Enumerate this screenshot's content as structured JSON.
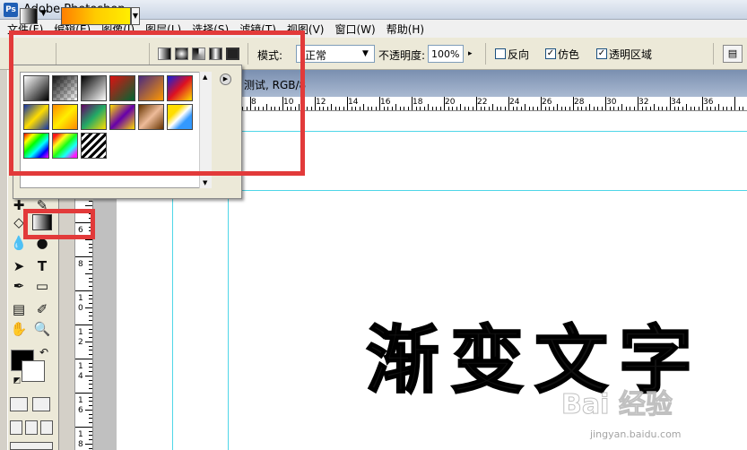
{
  "window": {
    "title": "Adobe Photoshop"
  },
  "menu": [
    "文件(F)",
    "编辑(E)",
    "图像(I)",
    "图层(L)",
    "选择(S)",
    "滤镜(T)",
    "视图(V)",
    "窗口(W)",
    "帮助(H)"
  ],
  "options": {
    "mode_label": "模式:",
    "mode_value": "正常",
    "opacity_label": "不透明度:",
    "opacity_value": "100%",
    "reverse_label": "反向",
    "dither_label": "仿色",
    "transparency_label": "透明区域",
    "reverse_checked": false,
    "dither_checked": true,
    "transparency_checked": true
  },
  "document": {
    "title": "测试, RGB/8"
  },
  "ruler": {
    "h_labels": [
      "8",
      "10",
      "12",
      "14",
      "16",
      "18",
      "20",
      "22",
      "24",
      "26",
      "28",
      "30",
      "32",
      "34",
      "36"
    ],
    "v_labels": [
      "6",
      "8",
      "10",
      "12",
      "14",
      "16",
      "18"
    ]
  },
  "canvas": {
    "text": "渐变文字"
  },
  "watermark": {
    "logo": "Bai 经验",
    "url": "jingyan.baidu.com"
  },
  "colors": {
    "annotation": "#e23a3a",
    "guide": "#4fd6e8"
  }
}
